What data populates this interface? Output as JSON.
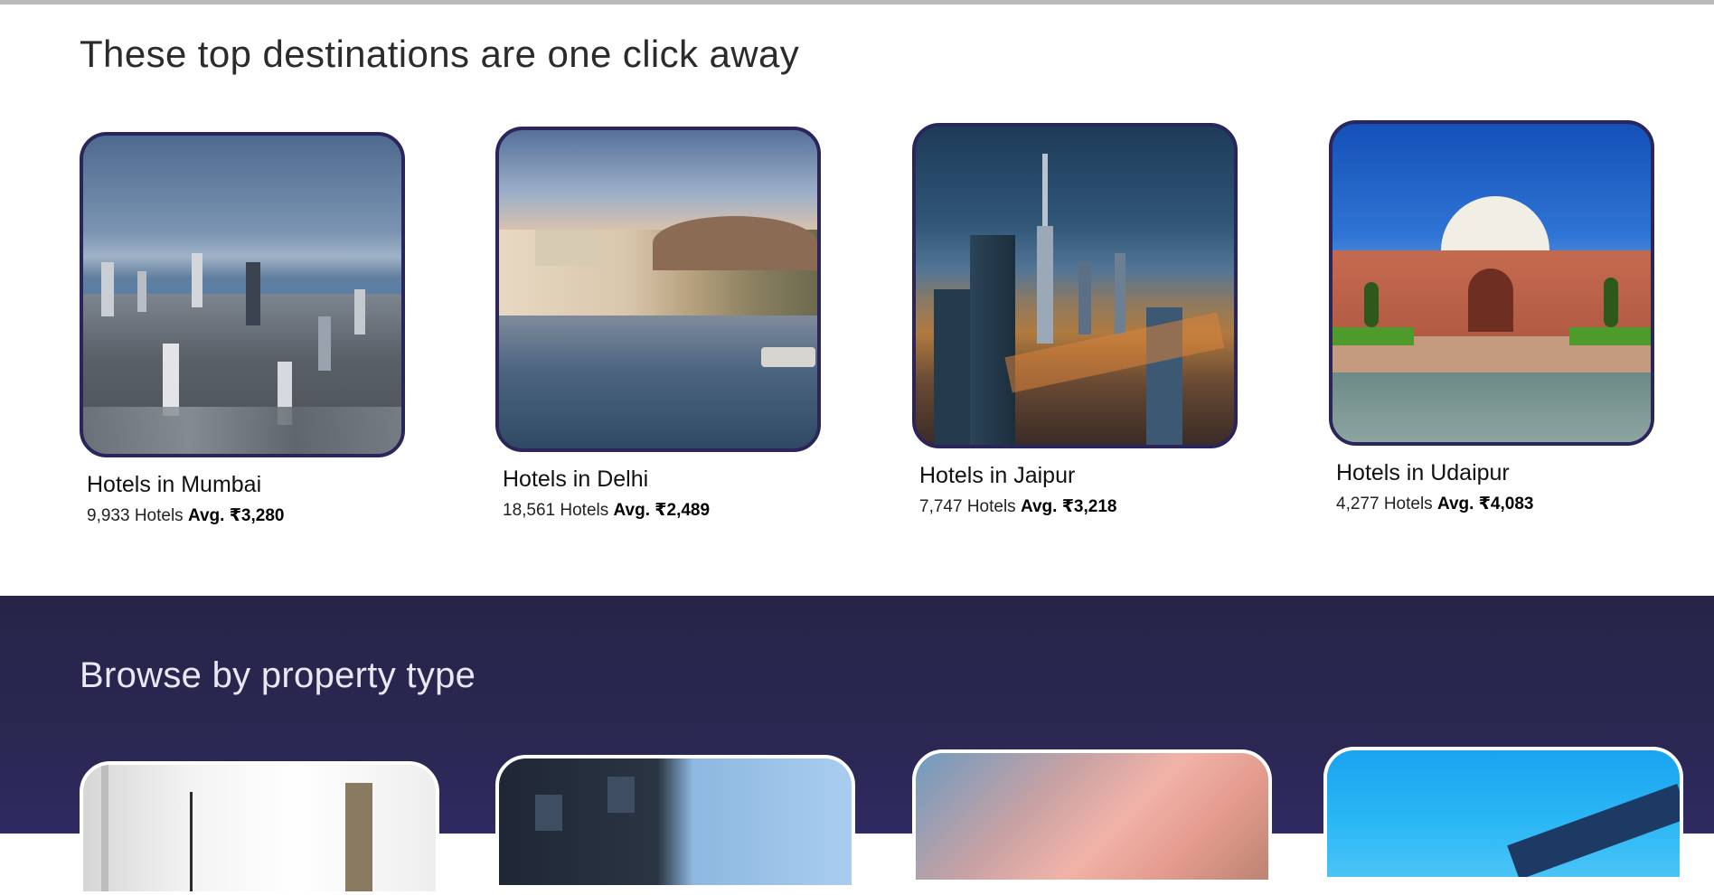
{
  "section_destinations": {
    "title": "These top destinations are one click away",
    "cards": [
      {
        "name": "Hotels in Mumbai",
        "count": "9,933 Hotels",
        "avg": "Avg. ₹3,280",
        "image": "mumbai-skyline-photo"
      },
      {
        "name": "Hotels in Delhi",
        "count": "18,561 Hotels",
        "avg": "Avg. ₹2,489",
        "image": "lake-palace-photo"
      },
      {
        "name": "Hotels in Jaipur",
        "count": "7,747 Hotels",
        "avg": "Avg. ₹3,218",
        "image": "city-night-skyline-photo"
      },
      {
        "name": "Hotels in Udaipur",
        "count": "4,277 Hotels",
        "avg": "Avg. ₹4,083",
        "image": "humayun-tomb-photo"
      }
    ]
  },
  "section_property": {
    "title": "Browse by property type",
    "cards": [
      {
        "image": "white-interior-room-photo"
      },
      {
        "image": "modern-building-photo"
      },
      {
        "image": "pink-cloud-sky-photo"
      },
      {
        "image": "blue-sky-building-photo"
      }
    ]
  },
  "colors": {
    "card_border": "#2a255a",
    "browse_bg": "#2a2752",
    "property_border": "#ffffff"
  }
}
